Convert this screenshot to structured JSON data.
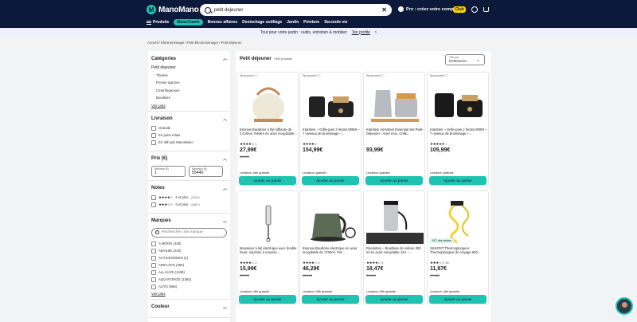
{
  "header": {
    "logo": "ManoMano",
    "logo_mark": "M",
    "search_value": "petit dejeuner",
    "search_clear": "✕",
    "pro_text": "Pro : créez votre compte",
    "club": "Club",
    "icons": [
      "search-icon",
      "user-icon",
      "cart-icon"
    ]
  },
  "nav": {
    "products": "Produits",
    "manocoach": "ManoCoach",
    "items": [
      "Bonnes affaires",
      "Destockage outillage",
      "Jardin",
      "Peinture",
      "Seconde vie"
    ]
  },
  "promo": {
    "text": "Tout pour votre jardin : outils, entretien & mobilier",
    "link": "Ten profite",
    "chevron": "›"
  },
  "breadcrumb": "Accueil / Électroménager / Petit Électroménager / Petit déjeuner",
  "sidebar": {
    "categories": {
      "title": "Catégories",
      "main": "Petit déjeuner",
      "subs": [
        "Théière",
        "Presse agrume",
        "Centrifugeuses",
        "Bouilloire"
      ],
      "see_more": "Voir plus"
    },
    "delivery": {
      "title": "Livraison",
      "options": [
        "Gratuite",
        "En point relais",
        "En 48h par ManoMano"
      ]
    },
    "price": {
      "title": "Prix (€)",
      "min_label": "Minimum (€)",
      "min_value": "1",
      "max_label": "Maximum (€)",
      "max_value": "55440"
    },
    "ratings": {
      "title": "Notes",
      "rows": [
        {
          "stars": "★★★★☆",
          "label": "4 et plus",
          "count": "(1441)",
          "value": 4
        },
        {
          "stars": "★★★☆☆",
          "label": "3 et plus",
          "count": "(1687)",
          "value": 3
        }
      ]
    },
    "brands": {
      "title": "Marques",
      "search_placeholder": "Rechercher une marque",
      "items": [
        "A MOON (436)",
        "ABYSSE (220)",
        "ACTIVEGREEN (1)",
        "AIRFLAPS (465)",
        "ALLAUVE (1436)",
        "AQUAFORGE (1360)",
        "AUTO (969)"
      ],
      "see_more": "Voir plus"
    },
    "colors_title": "Couleur"
  },
  "main": {
    "title": "Petit déjeuner",
    "count": "+500 produits",
    "sort_label": "Trier par",
    "sort_value": "Pertinence",
    "cta": "Ajouter au panier",
    "products": [
      {
        "sponsor": "Sponsorisé ⓘ",
        "name": "Esonow Bouilloire à thé sifflante de 2,5 litres, théière en acier inoxydable...",
        "stars": "★★★★☆",
        "reviews": "1",
        "rating": 4,
        "price": "27,99€",
        "old": "39,60€",
        "delivery": "Livraison 48h gratuite",
        "color": "#eee8d8",
        "accent": "#c68a5a"
      },
      {
        "sponsor": "Sponsorisé ⓘ",
        "name": "Klarstein – Grille-pain 2 fentes 800W – 7 niveaux de brunissage –...",
        "stars": "★★★★☆",
        "reviews": "",
        "rating": 4,
        "price": "154,99€",
        "old": "",
        "delivery": "Livraison gratuite",
        "color": "#222222",
        "accent": "#c9a063"
      },
      {
        "sponsor": "Sponsorisé ⓘ",
        "name": "Klarstein Vornsteel Essential Set Petit-Déjeuner - Acier inox, Grille...",
        "stars": "",
        "reviews": "",
        "rating": 0,
        "price": "93,99€",
        "old": "",
        "delivery": "Livraison gratuite",
        "color": "#b8bcc0",
        "accent": "#d49a4a"
      },
      {
        "sponsor": "Sponsorisé ⓘ",
        "name": "Klarstein – Grille-pain 2 fentes 800W – 7 niveaux de brunissage –...",
        "stars": "★★★★★",
        "reviews": "1",
        "rating": 5,
        "price": "105,99€",
        "old": "",
        "delivery": "Livraison gratuite",
        "color": "#1a1a1a",
        "accent": "#c9a063"
      },
      {
        "sponsor": "",
        "name": "Mousseur à lait électrique avec double fouet, machine à mousse...",
        "stars": "★★★★☆",
        "reviews": "2",
        "rating": 4,
        "price": "15,99€",
        "old": "27,97€",
        "delivery": "Livraison 48h gratuite",
        "color": "#f4f4f4",
        "accent": "#222222"
      },
      {
        "sponsor": "",
        "name": "Esonow Bouilloire électrique en acier inoxydable de 1700ml, Pot...",
        "stars": "★★★★☆",
        "reviews": "6",
        "rating": 4,
        "price": "46,29€",
        "old": "63,99€",
        "delivery": "Livraison 48h gratuite",
        "color": "#5b6b55",
        "accent": "#2a2a2a"
      },
      {
        "sponsor": "",
        "name": "Rnemitery – Bouilloire de voiture 300 ml en acier inoxydable 12V –...",
        "stars": "★★★★☆",
        "reviews": "4",
        "rating": 4,
        "price": "18,47€",
        "old": "31,40€",
        "delivery": "Livraison 48h gratuite",
        "color": "#c7cacd",
        "accent": "#1a1a1a"
      },
      {
        "sponsor": "",
        "name": "SILERST Thermoplongeur Thermoplongeur de Voyage 600...",
        "stars": "★★★☆☆",
        "reviews": "36",
        "rating": 3,
        "price": "11,87€",
        "old": "17,36€",
        "delivery": "Livraison 48h gratuite",
        "color": "#f2d233",
        "accent": "#e0c020",
        "badge": "N°1 des ventes"
      }
    ]
  }
}
